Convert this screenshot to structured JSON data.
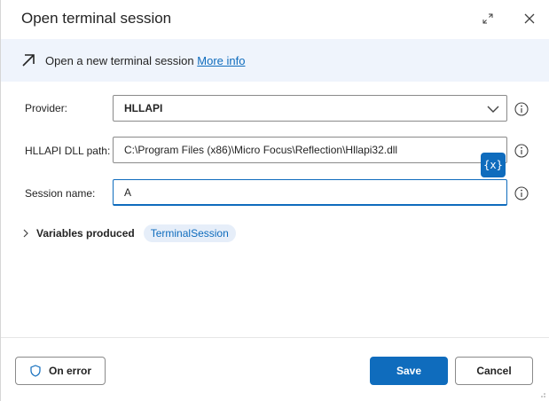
{
  "dialog": {
    "title": "Open terminal session",
    "expand_icon": "expand-icon",
    "close_icon": "close-icon"
  },
  "banner": {
    "text": "Open a new terminal session",
    "link": "More info",
    "icon": "arrow-up-right-icon"
  },
  "form": {
    "provider": {
      "label": "Provider:",
      "value": "HLLAPI"
    },
    "dll_path": {
      "label": "HLLAPI DLL path:",
      "value": "C:\\Program Files (x86)\\Micro Focus\\Reflection\\Hllapi32.dll"
    },
    "session_name": {
      "label": "Session name:",
      "value": "A"
    },
    "variable_button": "{x}"
  },
  "variables": {
    "label": "Variables produced",
    "chips": [
      "TerminalSession"
    ]
  },
  "footer": {
    "on_error": "On error",
    "save": "Save",
    "cancel": "Cancel"
  },
  "colors": {
    "accent": "#0f6cbd",
    "banner_bg": "#eff4fc",
    "chip_bg": "#e6eef9"
  }
}
